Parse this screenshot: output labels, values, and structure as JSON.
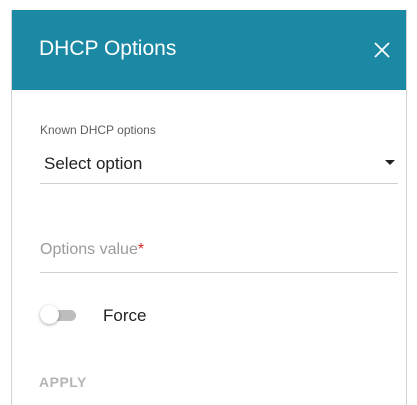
{
  "dialog": {
    "title": "DHCP Options",
    "header_color": "#1b89a4",
    "close_icon": "close-icon"
  },
  "known_options": {
    "label": "Known DHCP options",
    "selected_value": "Select option",
    "dropdown_icon": "caret-down-icon"
  },
  "options_value": {
    "placeholder": "Options value",
    "required_marker": "*",
    "value": ""
  },
  "force": {
    "label": "Force",
    "enabled": false
  },
  "actions": {
    "apply_label": "APPLY",
    "apply_enabled": false
  },
  "colors": {
    "required": "#d02a2a",
    "disabled_text": "#b5b5b5"
  }
}
